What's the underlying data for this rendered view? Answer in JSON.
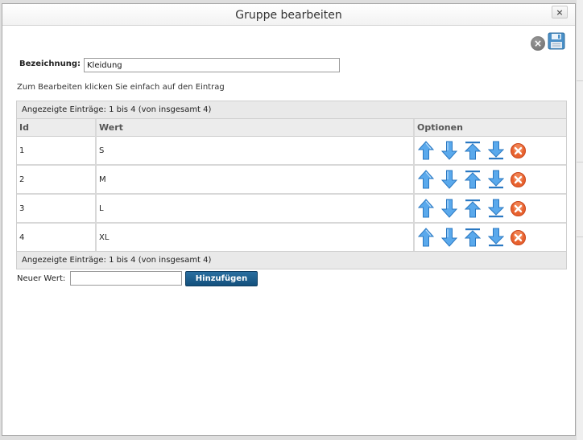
{
  "dialog": {
    "title": "Gruppe bearbeiten",
    "close_label": "×"
  },
  "toolbar": {
    "cancel_label": "×"
  },
  "form": {
    "name_label": "Bezeichnung:",
    "name_value": "Kleidung"
  },
  "hint": "Zum Bearbeiten klicken Sie einfach auf den Eintrag",
  "grid": {
    "info_top": "Angezeigte Einträge: 1 bis 4 (von insgesamt 4)",
    "info_bottom": "Angezeigte Einträge: 1 bis 4 (von insgesamt 4)",
    "columns": [
      "Id",
      "Wert",
      "Optionen"
    ],
    "rows": [
      {
        "id": "1",
        "value": "S"
      },
      {
        "id": "2",
        "value": "M"
      },
      {
        "id": "3",
        "value": "L"
      },
      {
        "id": "4",
        "value": "XL"
      }
    ],
    "row_icons": [
      "arrow-up-icon",
      "arrow-down-icon",
      "move-to-top-icon",
      "move-to-bottom-icon",
      "delete-icon"
    ]
  },
  "add": {
    "label": "Neuer Wert:",
    "value": "",
    "button": "Hinzufügen"
  },
  "colors": {
    "accent_button": "#1b5d8c",
    "icon_blue": "#3d8fd9",
    "delete_red": "#e05a2b"
  }
}
